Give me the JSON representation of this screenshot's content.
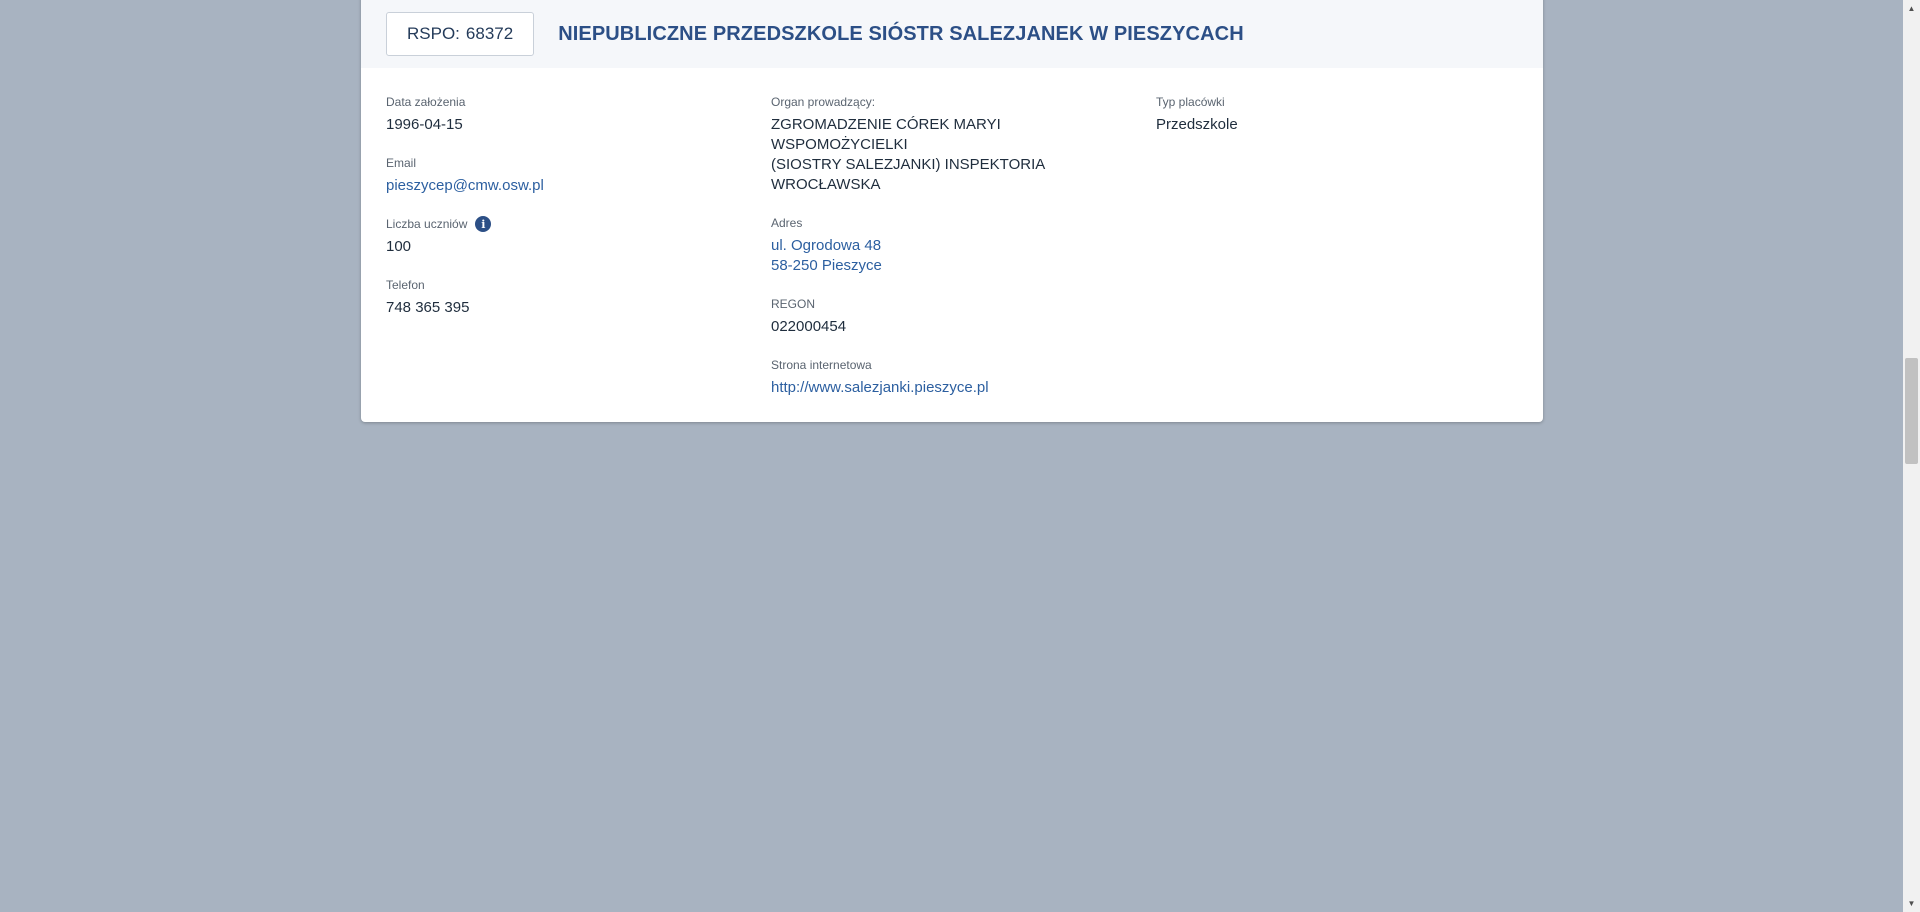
{
  "header": {
    "rspo_label": "RSPO:",
    "rspo_number": "68372",
    "title": "NIEPUBLICZNE PRZEDSZKOLE SIÓSTR SALEZJANEK W PIESZYCACH"
  },
  "fields": {
    "founded": {
      "label": "Data założenia",
      "value": "1996-04-15"
    },
    "email": {
      "label": "Email",
      "value": "pieszycep@cmw.osw.pl"
    },
    "students": {
      "label": "Liczba uczniów",
      "value": "100",
      "info_icon": "info-icon"
    },
    "phone": {
      "label": "Telefon",
      "value": "748 365 395"
    },
    "organ": {
      "label": "Organ prowadzący:",
      "value_line1": "ZGROMADZENIE CÓREK MARYI WSPOMOŻYCIELKI",
      "value_line2": "(SIOSTRY SALEZJANKI) INSPEKTORIA",
      "value_line3": "WROCŁAWSKA"
    },
    "address": {
      "label": "Adres",
      "line1": "ul. Ogrodowa 48",
      "line2": "58-250 Pieszyce"
    },
    "regon": {
      "label": "REGON",
      "value": "022000454"
    },
    "website": {
      "label": "Strona internetowa",
      "value": "http://www.salezjanki.pieszyce.pl"
    },
    "type": {
      "label": "Typ placówki",
      "value": "Przedszkole"
    }
  },
  "colors": {
    "page_background": "#a8b3c1",
    "title_color": "#2c4f86",
    "link_color": "#2c5fa0",
    "header_background": "#f5f7fa"
  },
  "scrollbar": {
    "up_icon": "scroll-up-arrow-icon",
    "down_icon": "scroll-down-arrow-icon"
  }
}
